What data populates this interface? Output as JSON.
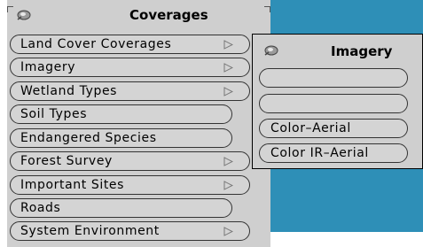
{
  "main_menu": {
    "title": "Coverages",
    "items": [
      {
        "label": "Land Cover Coverages",
        "submenu": true
      },
      {
        "label": "Imagery",
        "submenu": true
      },
      {
        "label": "Wetland Types",
        "submenu": true
      },
      {
        "label": "Soil Types",
        "submenu": false
      },
      {
        "label": "Endangered Species",
        "submenu": false
      },
      {
        "label": "Forest Survey",
        "submenu": true
      },
      {
        "label": "Important Sites",
        "submenu": true
      },
      {
        "label": "Roads",
        "submenu": false
      },
      {
        "label": "System Environment",
        "submenu": true
      }
    ]
  },
  "sub_menu": {
    "title": "Imagery",
    "items": [
      {
        "label": ""
      },
      {
        "label": ""
      },
      {
        "label": "Color–Aerial"
      },
      {
        "label": "Color IR–Aerial"
      }
    ]
  },
  "colors": {
    "desktop": "#2e8fb7",
    "menu_bg": "#cfcfcf"
  },
  "icons": {
    "pin": "pushpin-icon",
    "submenu_arrow": "triangle-right-icon"
  }
}
